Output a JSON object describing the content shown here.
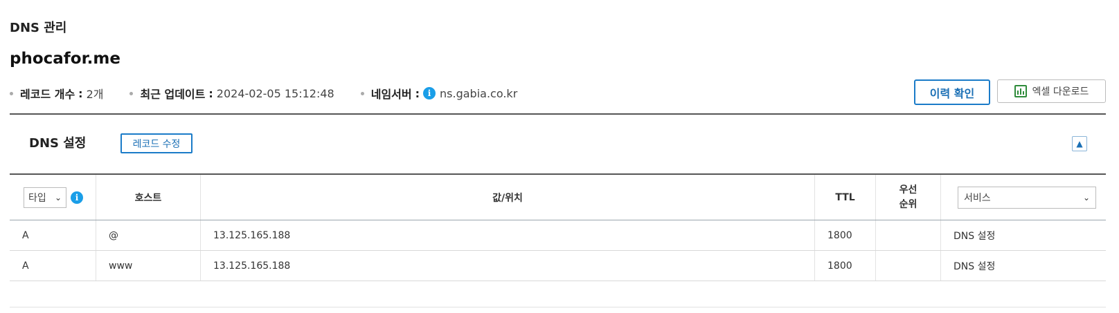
{
  "page": {
    "section_label": "DNS 관리",
    "domain": "phocafor.me"
  },
  "meta": {
    "record_count": {
      "label": "레코드 개수",
      "value": "2개"
    },
    "last_update": {
      "label": "최근 업데이트",
      "value": "2024-02-05 15:12:48"
    },
    "nameserver": {
      "label": "네임서버",
      "value": "ns.gabia.co.kr"
    }
  },
  "actions": {
    "history_label": "이력 확인",
    "excel_label": "엑셀 다운로드"
  },
  "dns_settings": {
    "title": "DNS 설정",
    "edit_label": "레코드 수정",
    "collapse_icon": "chevron-up-icon"
  },
  "table": {
    "type_filter": "타입",
    "columns": {
      "host": "호스트",
      "value": "값/위치",
      "ttl": "TTL",
      "priority_line1": "우선",
      "priority_line2": "순위"
    },
    "service_filter": "서비스",
    "rows": [
      {
        "type": "A",
        "host": "@",
        "value": "13.125.165.188",
        "ttl": "1800",
        "priority": "",
        "service": "DNS 설정"
      },
      {
        "type": "A",
        "host": "www",
        "value": "13.125.165.188",
        "ttl": "1800",
        "priority": "",
        "service": "DNS 설정"
      }
    ]
  },
  "colors": {
    "accent": "#1a7bc8",
    "info": "#1a9ee8",
    "excel": "#2e8b3a"
  }
}
